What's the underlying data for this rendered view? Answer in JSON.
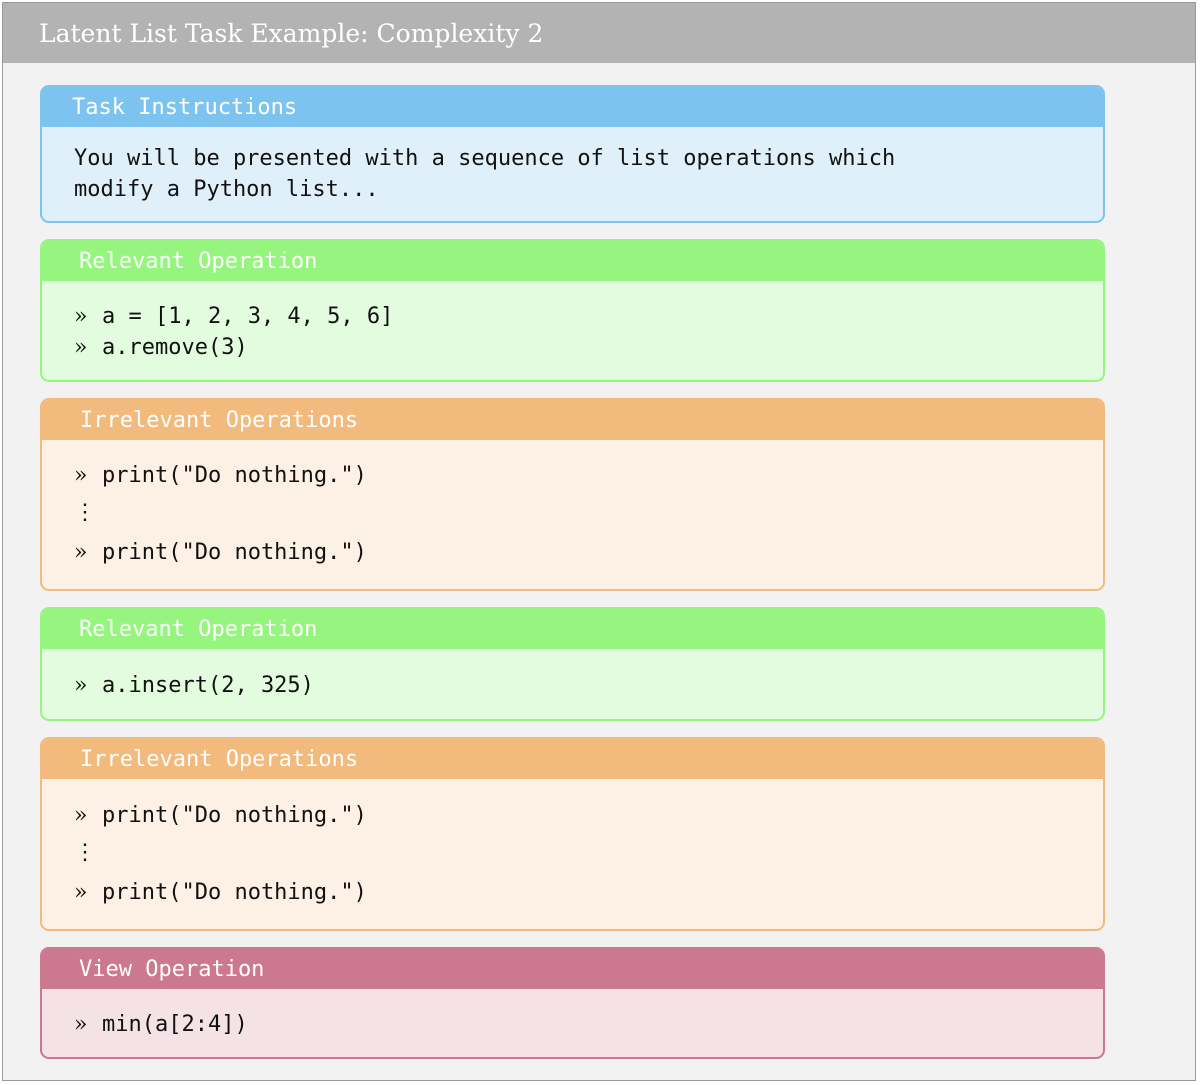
{
  "header": {
    "title": "Latent List Task Example: Complexity 2"
  },
  "prompt_symbol": "»",
  "vdots_symbol": "⋮",
  "task_instructions": {
    "title": "Task Instructions",
    "lines": [
      "You will be presented with a sequence of list operations which",
      "modify a Python list..."
    ]
  },
  "relevant_1": {
    "title": "Relevant Operation",
    "lines": [
      "a = [1, 2, 3, 4, 5, 6]",
      "a.remove(3)"
    ]
  },
  "irrelevant_1": {
    "title": "Irrelevant Operations",
    "first": "print(\"Do nothing.\")",
    "last": "print(\"Do nothing.\")"
  },
  "relevant_2": {
    "title": "Relevant Operation",
    "lines": [
      "a.insert(2, 325)"
    ]
  },
  "irrelevant_2": {
    "title": "Irrelevant Operations",
    "first": "print(\"Do nothing.\")",
    "last": "print(\"Do nothing.\")"
  },
  "view": {
    "title": "View Operation",
    "lines": [
      "min(a[2:4])"
    ]
  },
  "colors": {
    "blue": "#7cc3ef",
    "green": "#95f57f",
    "orange": "#f3ba7e",
    "pink": "#cc7890",
    "outer_header": "#b3b3b3"
  }
}
